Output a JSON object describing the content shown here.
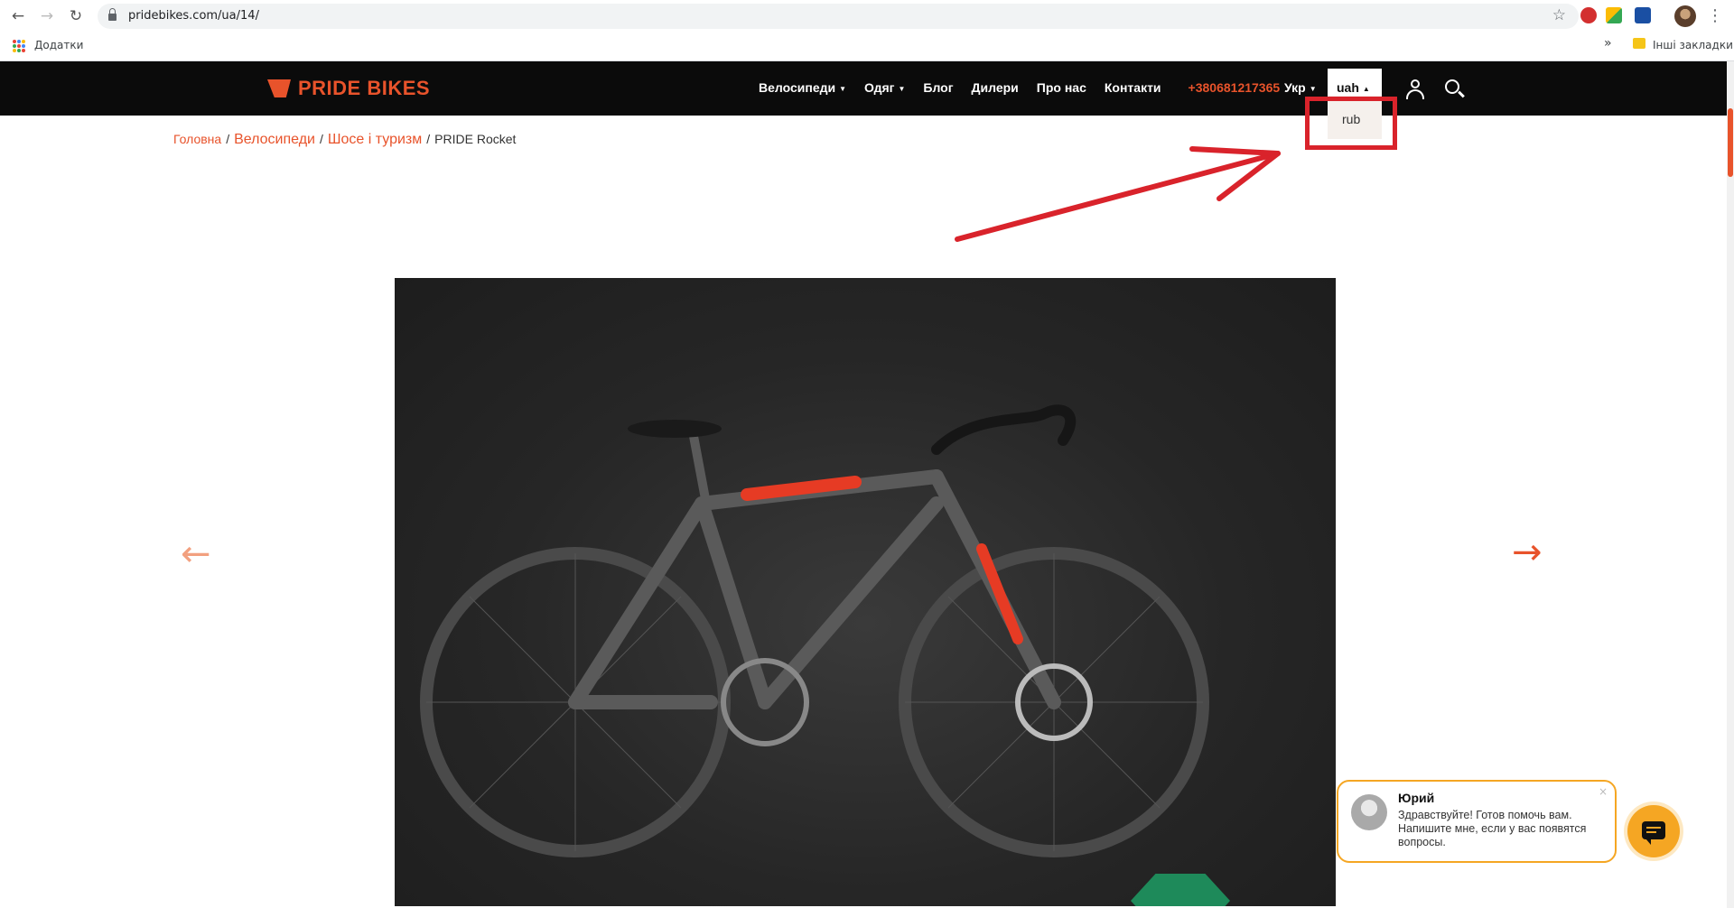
{
  "browser": {
    "url": "pridebikes.com/ua/14/",
    "bookmarks_apps_label": "Додатки",
    "bookmarks_other_label": "Інші закладки",
    "bookmarks_overflow": "»"
  },
  "site": {
    "logo_text": "PRIDE BIKES",
    "menu": [
      {
        "label": "Велосипеди",
        "has_caret": true
      },
      {
        "label": "Одяг",
        "has_caret": true
      },
      {
        "label": "Блог",
        "has_caret": false
      },
      {
        "label": "Дилери",
        "has_caret": false
      },
      {
        "label": "Про нас",
        "has_caret": false
      },
      {
        "label": "Контакти",
        "has_caret": false
      }
    ],
    "phone": "+380681217365",
    "language": "Укр",
    "currency": {
      "selected": "uah",
      "options": [
        "rub"
      ]
    },
    "brand_color": "#e8532b"
  },
  "breadcrumb": {
    "home": "Головна",
    "bikes": "Велосипеди",
    "category": "Шосе і туризм",
    "current": "PRIDE Rocket",
    "separator": "/"
  },
  "product": {
    "image_icon": "bike-photo"
  },
  "chat": {
    "agent_name": "Юрий",
    "message": "Здравствуйте! Готов помочь вам. Напишите мне, если у вас появятся вопросы.",
    "close_glyph": "×",
    "accent": "#f5a623"
  },
  "annotation": {
    "color": "#d9232b"
  }
}
